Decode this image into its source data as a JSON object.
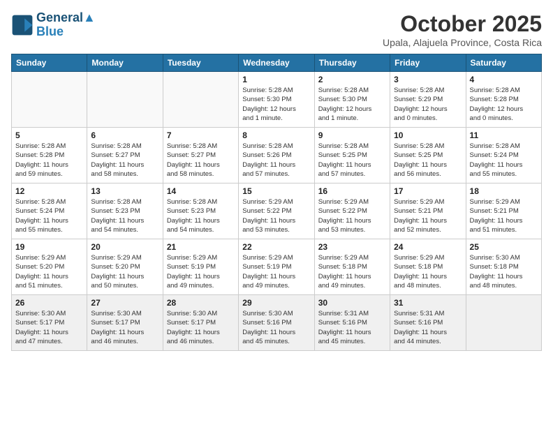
{
  "header": {
    "logo_line1": "General",
    "logo_line2": "Blue",
    "month": "October 2025",
    "location": "Upala, Alajuela Province, Costa Rica"
  },
  "weekdays": [
    "Sunday",
    "Monday",
    "Tuesday",
    "Wednesday",
    "Thursday",
    "Friday",
    "Saturday"
  ],
  "weeks": [
    [
      {
        "day": "",
        "info": ""
      },
      {
        "day": "",
        "info": ""
      },
      {
        "day": "",
        "info": ""
      },
      {
        "day": "1",
        "info": "Sunrise: 5:28 AM\nSunset: 5:30 PM\nDaylight: 12 hours\nand 1 minute."
      },
      {
        "day": "2",
        "info": "Sunrise: 5:28 AM\nSunset: 5:30 PM\nDaylight: 12 hours\nand 1 minute."
      },
      {
        "day": "3",
        "info": "Sunrise: 5:28 AM\nSunset: 5:29 PM\nDaylight: 12 hours\nand 0 minutes."
      },
      {
        "day": "4",
        "info": "Sunrise: 5:28 AM\nSunset: 5:28 PM\nDaylight: 12 hours\nand 0 minutes."
      }
    ],
    [
      {
        "day": "5",
        "info": "Sunrise: 5:28 AM\nSunset: 5:28 PM\nDaylight: 11 hours\nand 59 minutes."
      },
      {
        "day": "6",
        "info": "Sunrise: 5:28 AM\nSunset: 5:27 PM\nDaylight: 11 hours\nand 58 minutes."
      },
      {
        "day": "7",
        "info": "Sunrise: 5:28 AM\nSunset: 5:27 PM\nDaylight: 11 hours\nand 58 minutes."
      },
      {
        "day": "8",
        "info": "Sunrise: 5:28 AM\nSunset: 5:26 PM\nDaylight: 11 hours\nand 57 minutes."
      },
      {
        "day": "9",
        "info": "Sunrise: 5:28 AM\nSunset: 5:25 PM\nDaylight: 11 hours\nand 57 minutes."
      },
      {
        "day": "10",
        "info": "Sunrise: 5:28 AM\nSunset: 5:25 PM\nDaylight: 11 hours\nand 56 minutes."
      },
      {
        "day": "11",
        "info": "Sunrise: 5:28 AM\nSunset: 5:24 PM\nDaylight: 11 hours\nand 55 minutes."
      }
    ],
    [
      {
        "day": "12",
        "info": "Sunrise: 5:28 AM\nSunset: 5:24 PM\nDaylight: 11 hours\nand 55 minutes."
      },
      {
        "day": "13",
        "info": "Sunrise: 5:28 AM\nSunset: 5:23 PM\nDaylight: 11 hours\nand 54 minutes."
      },
      {
        "day": "14",
        "info": "Sunrise: 5:28 AM\nSunset: 5:23 PM\nDaylight: 11 hours\nand 54 minutes."
      },
      {
        "day": "15",
        "info": "Sunrise: 5:29 AM\nSunset: 5:22 PM\nDaylight: 11 hours\nand 53 minutes."
      },
      {
        "day": "16",
        "info": "Sunrise: 5:29 AM\nSunset: 5:22 PM\nDaylight: 11 hours\nand 53 minutes."
      },
      {
        "day": "17",
        "info": "Sunrise: 5:29 AM\nSunset: 5:21 PM\nDaylight: 11 hours\nand 52 minutes."
      },
      {
        "day": "18",
        "info": "Sunrise: 5:29 AM\nSunset: 5:21 PM\nDaylight: 11 hours\nand 51 minutes."
      }
    ],
    [
      {
        "day": "19",
        "info": "Sunrise: 5:29 AM\nSunset: 5:20 PM\nDaylight: 11 hours\nand 51 minutes."
      },
      {
        "day": "20",
        "info": "Sunrise: 5:29 AM\nSunset: 5:20 PM\nDaylight: 11 hours\nand 50 minutes."
      },
      {
        "day": "21",
        "info": "Sunrise: 5:29 AM\nSunset: 5:19 PM\nDaylight: 11 hours\nand 49 minutes."
      },
      {
        "day": "22",
        "info": "Sunrise: 5:29 AM\nSunset: 5:19 PM\nDaylight: 11 hours\nand 49 minutes."
      },
      {
        "day": "23",
        "info": "Sunrise: 5:29 AM\nSunset: 5:18 PM\nDaylight: 11 hours\nand 49 minutes."
      },
      {
        "day": "24",
        "info": "Sunrise: 5:29 AM\nSunset: 5:18 PM\nDaylight: 11 hours\nand 48 minutes."
      },
      {
        "day": "25",
        "info": "Sunrise: 5:30 AM\nSunset: 5:18 PM\nDaylight: 11 hours\nand 48 minutes."
      }
    ],
    [
      {
        "day": "26",
        "info": "Sunrise: 5:30 AM\nSunset: 5:17 PM\nDaylight: 11 hours\nand 47 minutes."
      },
      {
        "day": "27",
        "info": "Sunrise: 5:30 AM\nSunset: 5:17 PM\nDaylight: 11 hours\nand 46 minutes."
      },
      {
        "day": "28",
        "info": "Sunrise: 5:30 AM\nSunset: 5:17 PM\nDaylight: 11 hours\nand 46 minutes."
      },
      {
        "day": "29",
        "info": "Sunrise: 5:30 AM\nSunset: 5:16 PM\nDaylight: 11 hours\nand 45 minutes."
      },
      {
        "day": "30",
        "info": "Sunrise: 5:31 AM\nSunset: 5:16 PM\nDaylight: 11 hours\nand 45 minutes."
      },
      {
        "day": "31",
        "info": "Sunrise: 5:31 AM\nSunset: 5:16 PM\nDaylight: 11 hours\nand 44 minutes."
      },
      {
        "day": "",
        "info": ""
      }
    ]
  ]
}
